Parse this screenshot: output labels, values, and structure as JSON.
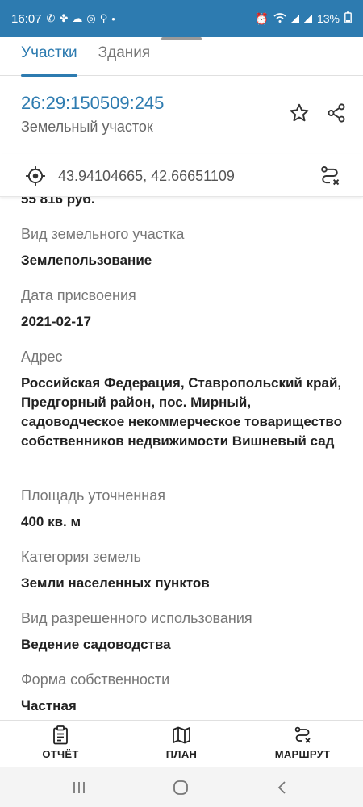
{
  "status_bar": {
    "time": "16:07",
    "battery": "13%",
    "icons": [
      "whatsapp-icon",
      "fan-icon",
      "cloud-icon",
      "notification-icon",
      "walk-icon",
      "dot-icon"
    ],
    "right_icons": [
      "alarm-icon",
      "wifi-icon",
      "signal-icon",
      "signal-icon",
      "battery-icon"
    ]
  },
  "tabs": [
    {
      "label": "Участки",
      "active": true
    },
    {
      "label": "Здания",
      "active": false
    }
  ],
  "header": {
    "cadastral_number": "26:29:150509:245",
    "object_type": "Земельный участок"
  },
  "coordinates": "43.94104665, 42.66651109",
  "cut_value": "55 816 руб.",
  "fields": [
    {
      "label": "Вид земельного участка",
      "value": "Землепользование"
    },
    {
      "label": "Дата присвоения",
      "value": "2021-02-17"
    },
    {
      "label": "Адрес",
      "value": "Российская Федерация, Ставропольский край, Предгорный район, пос. Мирный, садоводческое некоммерческое товарищество собственников недвижимости Вишневый сад"
    },
    {
      "label": "Площадь уточненная",
      "value": "400 кв. м"
    },
    {
      "label": "Категория земель",
      "value": "Земли населенных пунктов"
    },
    {
      "label": "Вид разрешенного использования",
      "value": "Ведение садоводства"
    },
    {
      "label": "Форма собственности",
      "value": "Частная"
    }
  ],
  "bottom_nav": [
    {
      "label": "ОТЧЁТ",
      "icon": "report-icon"
    },
    {
      "label": "ПЛАН",
      "icon": "map-icon"
    },
    {
      "label": "МАРШРУТ",
      "icon": "route-icon"
    }
  ],
  "colors": {
    "accent": "#2d7bb0",
    "status_bar": "#2d7bb0",
    "label_text": "#777777",
    "value_text": "#222222"
  }
}
